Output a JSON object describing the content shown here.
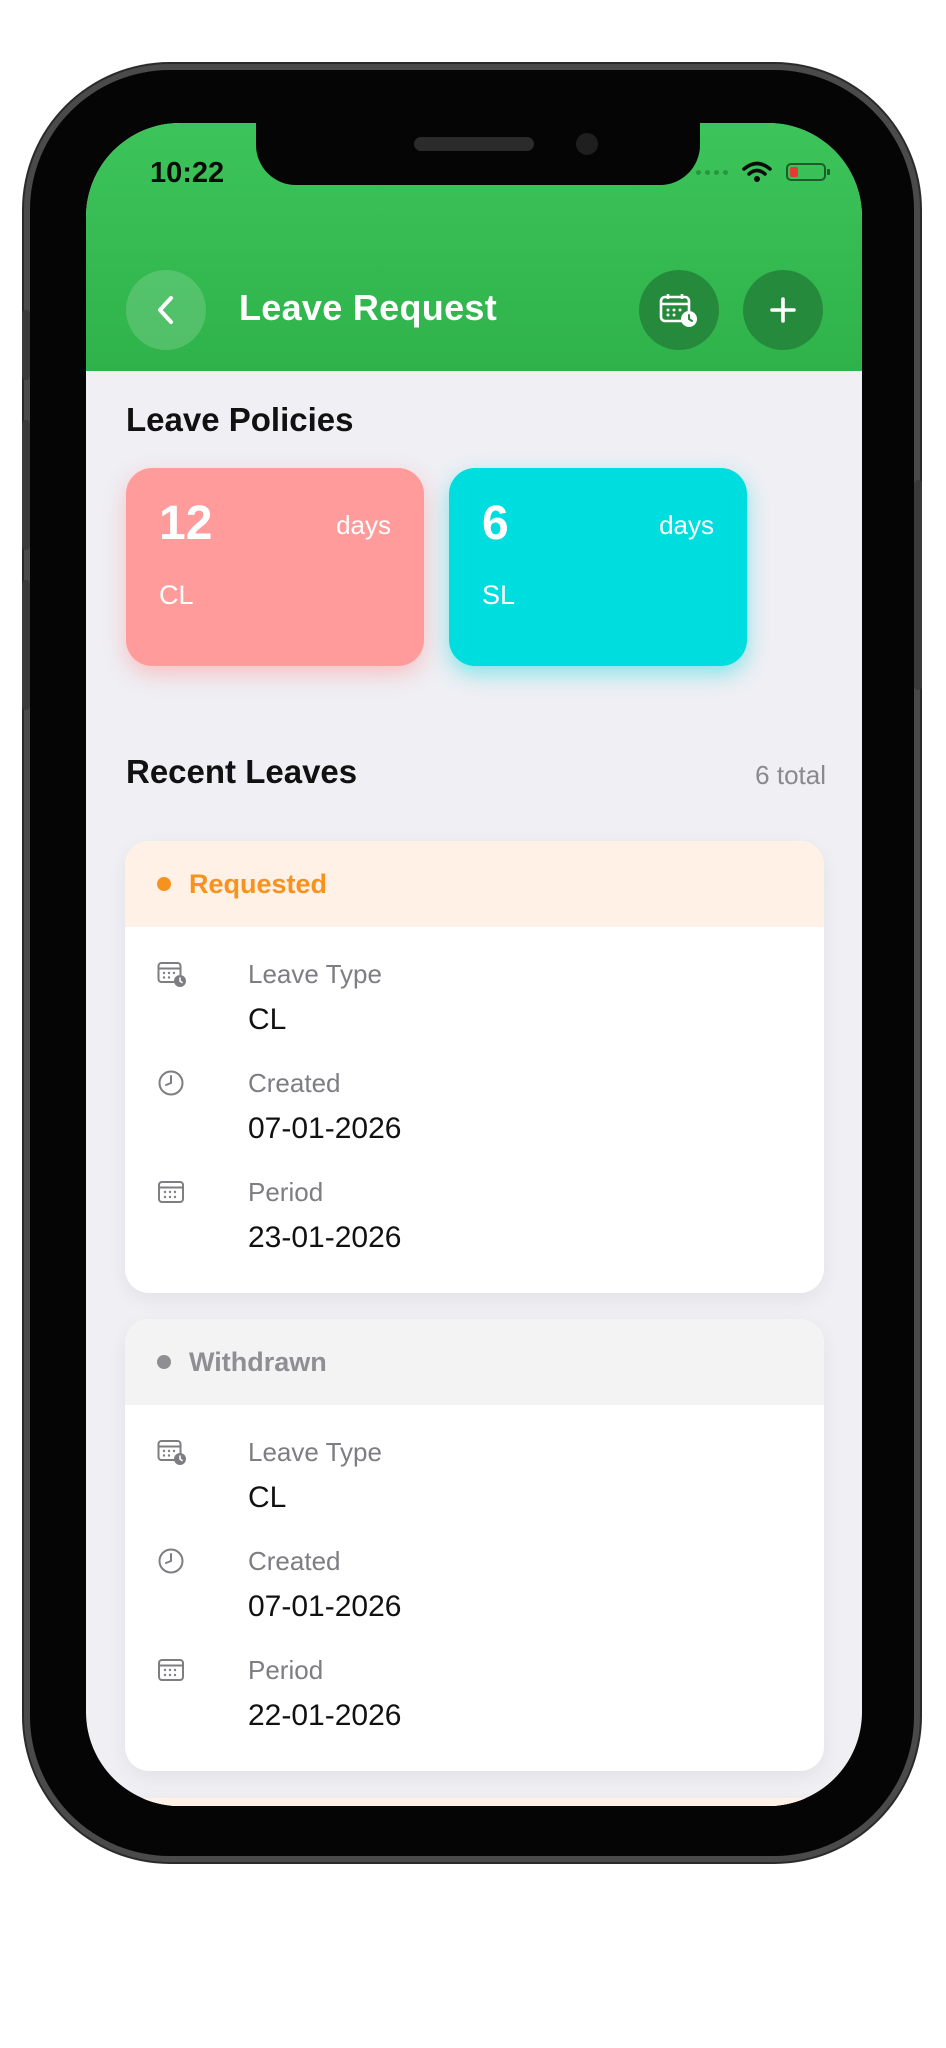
{
  "status_bar": {
    "time": "10:22"
  },
  "header": {
    "title": "Leave Request"
  },
  "policies": {
    "title": "Leave Policies",
    "items": [
      {
        "count": "12",
        "unit": "days",
        "code": "CL",
        "color": "#ff9b9b"
      },
      {
        "count": "6",
        "unit": "days",
        "code": "SL",
        "color": "#00dddf"
      }
    ]
  },
  "recent": {
    "title": "Recent Leaves",
    "total": "6 total",
    "leaves": [
      {
        "status": "Requested",
        "status_color": "#f7921e",
        "header_bg": "#fff1e6",
        "type_label": "Leave Type",
        "type_value": "CL",
        "created_label": "Created",
        "created_value": "07-01-2026",
        "period_label": "Period",
        "period_value": "23-01-2026"
      },
      {
        "status": "Withdrawn",
        "status_color": "#8e8e93",
        "header_bg": "#f3f3f4",
        "type_label": "Leave Type",
        "type_value": "CL",
        "created_label": "Created",
        "created_value": "07-01-2026",
        "period_label": "Period",
        "period_value": "22-01-2026"
      }
    ]
  },
  "colors": {
    "header_green": "#33b84e",
    "background": "#efeff4"
  }
}
